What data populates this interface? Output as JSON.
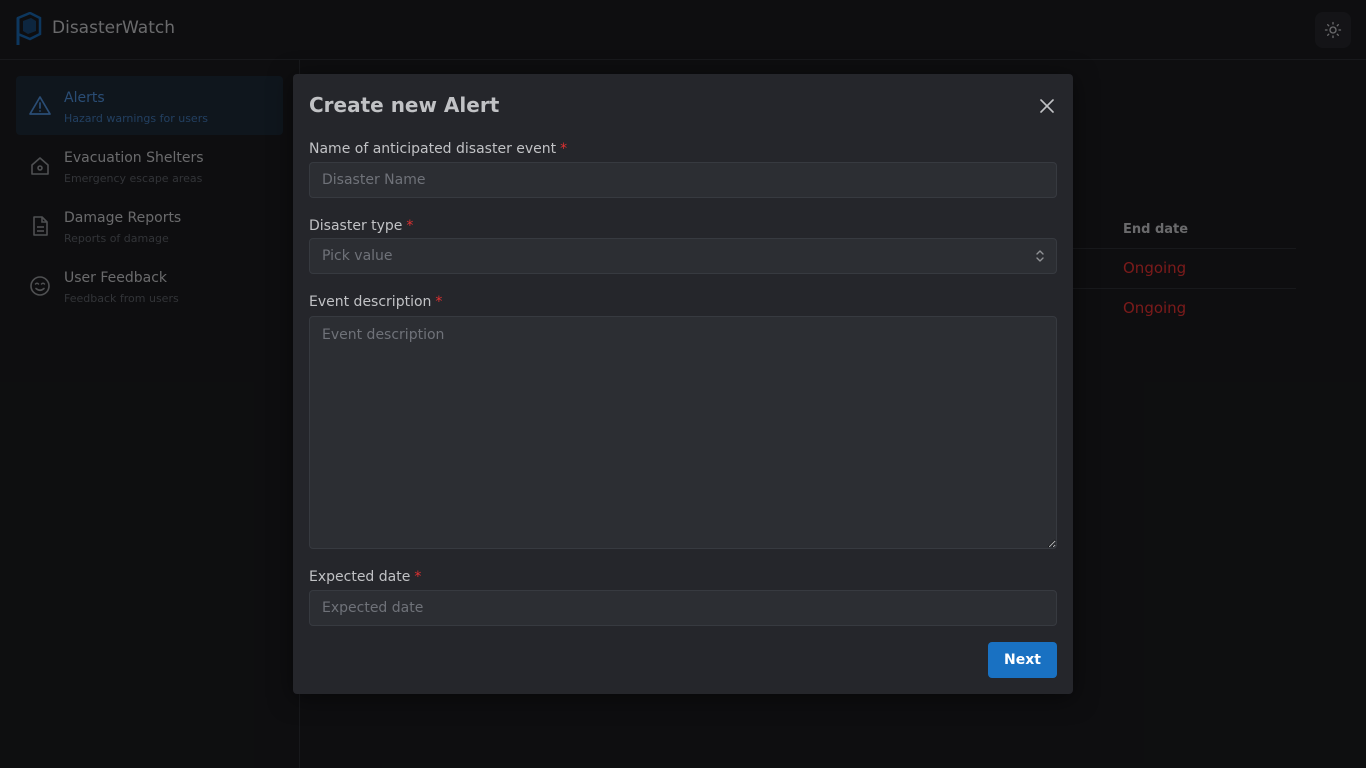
{
  "app": {
    "brand": "DisasterWatch",
    "accent_color": "#1971c2"
  },
  "header": {
    "theme_toggle_icon": "sun-icon"
  },
  "sidebar": {
    "items": [
      {
        "label": "Alerts",
        "description": "Hazard warnings for users",
        "icon": "alert-triangle-icon",
        "active": true
      },
      {
        "label": "Evacuation Shelters",
        "description": "Emergency escape areas",
        "icon": "home-icon",
        "active": false
      },
      {
        "label": "Damage Reports",
        "description": "Reports of damage",
        "icon": "document-icon",
        "active": false
      },
      {
        "label": "User Feedback",
        "description": "Feedback from users",
        "icon": "smiley-icon",
        "active": false
      }
    ]
  },
  "background_table": {
    "header": "End date",
    "rows": [
      "Ongoing",
      "Ongoing"
    ],
    "status_color": "#e03131"
  },
  "modal": {
    "title": "Create new Alert",
    "fields": {
      "name": {
        "label": "Name of anticipated disaster event",
        "placeholder": "Disaster Name",
        "value": ""
      },
      "type": {
        "label": "Disaster type",
        "placeholder": "Pick value",
        "value": ""
      },
      "description": {
        "label": "Event description",
        "placeholder": "Event description",
        "value": ""
      },
      "date": {
        "label": "Expected date",
        "placeholder": "Expected date",
        "value": ""
      }
    },
    "required_marker": "*",
    "next_label": "Next"
  }
}
